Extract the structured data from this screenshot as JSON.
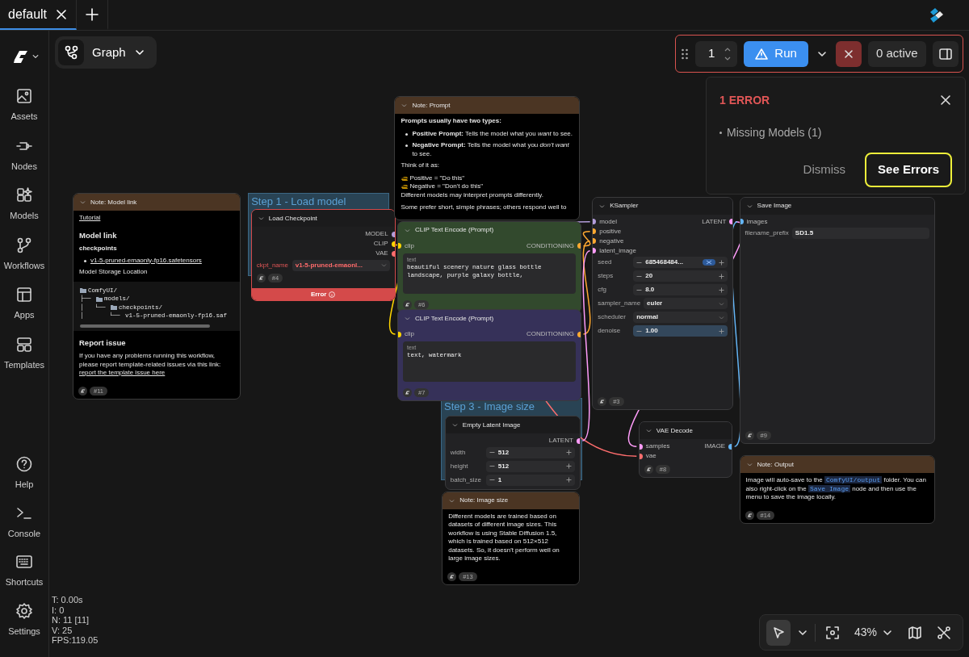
{
  "tabs": [
    {
      "label": "default",
      "selected": true
    }
  ],
  "sidebar": {
    "items": [
      {
        "label": "Assets"
      },
      {
        "label": "Nodes"
      },
      {
        "label": "Models"
      },
      {
        "label": "Workflows"
      },
      {
        "label": "Apps"
      },
      {
        "label": "Templates"
      }
    ],
    "bottom_items": [
      {
        "label": "Help"
      },
      {
        "label": "Console"
      },
      {
        "label": "Shortcuts"
      },
      {
        "label": "Settings"
      }
    ]
  },
  "view_switcher": {
    "label": "Graph"
  },
  "run_toolbar": {
    "queue_count": "1",
    "run_label": "Run",
    "active_label": "0 active"
  },
  "error_panel": {
    "title": "1 ERROR",
    "items": [
      "Missing Models (1)"
    ],
    "buttons": [
      {
        "label": "Dismiss",
        "highlighted": false
      },
      {
        "label": "See Errors",
        "highlighted": true
      }
    ]
  },
  "groups": [
    {
      "title": "Step 1 - Load model"
    },
    {
      "title": "Step 3 - Image size"
    }
  ],
  "nodes": [
    {
      "kind": "note",
      "title": "Note: Model link",
      "badge": "#11",
      "error": false,
      "blocks": [
        {
          "kind": "link",
          "text": "Tutorial"
        },
        {
          "kind": "heading",
          "text": "Model link"
        },
        {
          "kind": "subheading",
          "text": "checkpoints"
        },
        {
          "kind": "bullet",
          "link": "v1-5-pruned-emaonly-fp16.safetensors"
        },
        {
          "kind": "paragraph",
          "text": "Model Storage Location"
        },
        {
          "kind": "code",
          "lines": [
            {
              "text": "ComfyUI/",
              "kind": "folder"
            },
            {
              "prefix": "├── ",
              "text": "models/",
              "kind": "folder"
            },
            {
              "prefix": "│   └── ",
              "text": "checkpoints/",
              "kind": "folder"
            },
            {
              "prefix": "│       └── ",
              "text": "v1-5-pruned-emaonly-fp16.saf",
              "kind": "file"
            }
          ]
        },
        {
          "kind": "heading",
          "text": "Report issue"
        },
        {
          "kind": "paragraph",
          "text": "If you have any problems running this workflow, please report template-related issues via this link:",
          "link": "report the template issue here"
        }
      ]
    },
    {
      "kind": "node",
      "title": "Load Checkpoint",
      "badge": "#4",
      "error": true,
      "footer": "Error",
      "outputs": [
        {
          "label": "MODEL",
          "color": "#b39ddb"
        },
        {
          "label": "CLIP",
          "color": "#ffd500"
        },
        {
          "label": "VAE",
          "color": "#ff6e6e"
        }
      ],
      "widgets": [
        {
          "kind": "combo",
          "label": "ckpt_name",
          "value": "v1-5-pruned-emaonl..."
        }
      ]
    },
    {
      "kind": "note",
      "title": "Note: Prompt",
      "error": false,
      "blocks": [
        {
          "kind": "strong",
          "text": "Prompts usually have two types:"
        },
        {
          "kind": "bullet",
          "text": "**Positive Prompt:** Tells the model what you *want* to see."
        },
        {
          "kind": "bullet",
          "text": "**Negative Prompt:** Tells the model what you *don't want* to see."
        },
        {
          "kind": "paragraph",
          "text": "Think of it as:"
        },
        {
          "kind": "pointer",
          "text": "Positive = \"Do this\""
        },
        {
          "kind": "pointer",
          "text": "Negative = \"Don't do this\""
        },
        {
          "kind": "paragraph",
          "text": "Different models may interpret prompts differently."
        },
        {
          "kind": "paragraph",
          "text": "Some prefer short, simple phrases; others respond well to"
        }
      ]
    },
    {
      "kind": "node",
      "title": "CLIP Text Encode (Prompt)",
      "badge": "#6",
      "error": false,
      "color": "#32492d",
      "inputs": [
        {
          "label": "clip",
          "color": "#ffd500"
        }
      ],
      "outputs": [
        {
          "label": "CONDITIONING",
          "color": "#ffa931"
        }
      ],
      "widgets": [
        {
          "kind": "text",
          "label": "text",
          "value": "beautiful scenery nature glass bottle landscape, purple galaxy bottle,"
        }
      ]
    },
    {
      "kind": "node",
      "title": "CLIP Text Encode (Prompt)",
      "badge": "#7",
      "error": false,
      "color": "#363159",
      "inputs": [
        {
          "label": "clip",
          "color": "#ffd500"
        }
      ],
      "outputs": [
        {
          "label": "CONDITIONING",
          "color": "#ffa931"
        }
      ],
      "widgets": [
        {
          "kind": "text",
          "label": "text",
          "value": "text, watermark"
        }
      ]
    },
    {
      "kind": "node",
      "title": "KSampler",
      "badge": "#3",
      "error": false,
      "inputs": [
        {
          "label": "model",
          "color": "#b39ddb"
        },
        {
          "label": "positive",
          "color": "#ffa931"
        },
        {
          "label": "negative",
          "color": "#ffa931"
        },
        {
          "label": "latent_image",
          "color": "#ff9cf9"
        }
      ],
      "outputs": [
        {
          "label": "LATENT",
          "color": "#ff9cf9"
        }
      ],
      "widgets": [
        {
          "kind": "number",
          "label": "seed",
          "value": "685468484...",
          "randomize": true,
          "focused": false
        },
        {
          "kind": "number",
          "label": "steps",
          "value": "20",
          "randomize": false,
          "focused": false
        },
        {
          "kind": "number",
          "label": "cfg",
          "value": "8.0",
          "randomize": false,
          "focused": false
        },
        {
          "kind": "combo",
          "label": "sampler_name",
          "value": "euler",
          "focused": false
        },
        {
          "kind": "combo",
          "label": "scheduler",
          "value": "normal",
          "focused": false
        },
        {
          "kind": "number",
          "label": "denoise",
          "value": "1.00",
          "randomize": false,
          "focused": true
        }
      ]
    },
    {
      "kind": "node",
      "title": "Save Image",
      "badge": "#9",
      "error": false,
      "inputs": [
        {
          "label": "images",
          "color": "#64b5f6"
        }
      ],
      "widgets": [
        {
          "kind": "string",
          "label": "filename_prefix",
          "value": "SD1.5"
        }
      ]
    },
    {
      "kind": "node",
      "title": "Empty Latent Image",
      "error": false,
      "outputs": [
        {
          "label": "LATENT",
          "color": "#ff9cf9"
        }
      ],
      "widgets": [
        {
          "kind": "number",
          "label": "width",
          "value": "512"
        },
        {
          "kind": "number",
          "label": "height",
          "value": "512"
        },
        {
          "kind": "number",
          "label": "batch_size",
          "value": "1"
        }
      ]
    },
    {
      "kind": "node",
      "title": "VAE Decode",
      "badge": "#8",
      "error": false,
      "inputs": [
        {
          "label": "samples",
          "color": "#ff9cf9"
        },
        {
          "label": "vae",
          "color": "#ff6e6e"
        }
      ],
      "outputs": [
        {
          "label": "IMAGE",
          "color": "#64b5f6"
        }
      ]
    },
    {
      "kind": "note",
      "title": "Note: Image size",
      "badge": "#13",
      "error": false,
      "blocks": [
        {
          "kind": "paragraph",
          "text": "Different models are trained based on datasets of different image sizes. This workflow is using Stable Diffusion 1.5, which is trained based on 512×512 datasets. So, it doesn't perform well on large image sizes."
        }
      ]
    },
    {
      "kind": "note",
      "title": "Note: Output",
      "badge": "#14",
      "error": false,
      "blocks": [
        {
          "kind": "segments",
          "parts": [
            {
              "text": "Image will auto-save to the ",
              "code": false
            },
            {
              "text": "ComfyUI/output",
              "code": true
            },
            {
              "text": " folder. You can also right-click on the ",
              "code": false
            },
            {
              "text": "Save Image",
              "code": true
            },
            {
              "text": " node and then use the menu to save the image locally.",
              "code": false
            }
          ]
        }
      ]
    }
  ],
  "stats": [
    "T: 0.00s",
    "I: 0",
    "N: 11 [11]",
    "V: 25",
    "FPS:119.05"
  ],
  "canvas_tools": [
    {
      "kind": "pointer",
      "selected": true
    }
  ],
  "zoom_controls": {
    "zoom": "43%"
  }
}
